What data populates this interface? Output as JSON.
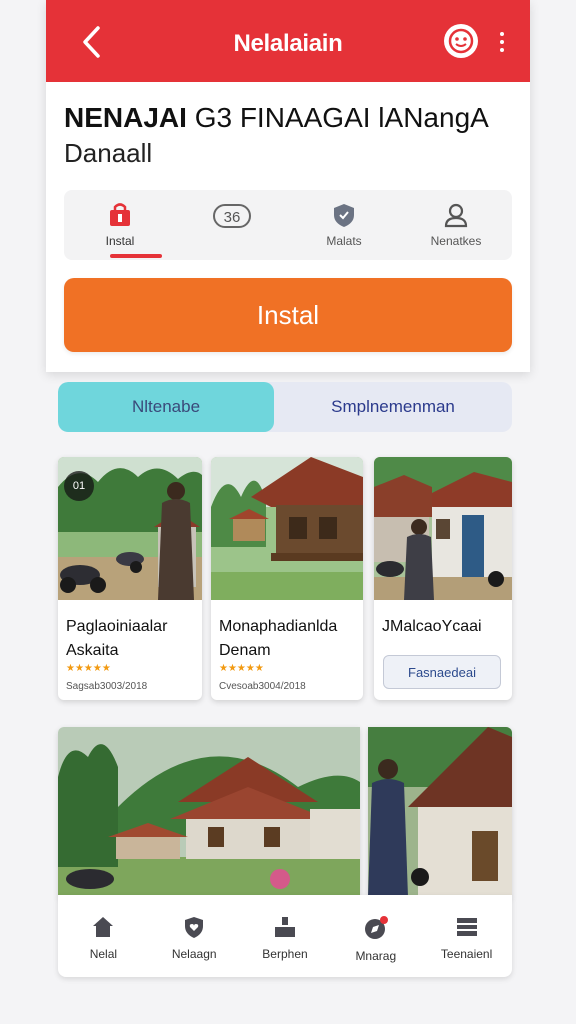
{
  "header": {
    "title": "Nelalaiain",
    "back_icon": "chevron-left-icon",
    "avatar_icon": "smiley-avatar-icon",
    "more_icon": "vertical-dots-icon",
    "bar_color": "#e53238"
  },
  "app": {
    "title_bold": "NENAJAI",
    "title_rest": " G3 FINAAGAI lANangA",
    "subtitle": "Danaall"
  },
  "tabs": [
    {
      "label": "Instal",
      "icon": "bag-icon",
      "active": true
    },
    {
      "label": "",
      "icon": "badge-36-icon",
      "active": false
    },
    {
      "label": "Malats",
      "icon": "shield-icon",
      "active": false
    },
    {
      "label": "Nenatkes",
      "icon": "user-icon",
      "active": false
    }
  ],
  "install_button": {
    "label": "Instal",
    "color": "#f07125"
  },
  "segment": {
    "active_label": "Nltenabe",
    "inactive_label": "Smplnemenman",
    "active_color": "#6fd6dc"
  },
  "cards": [
    {
      "title_line1": "Paglaoiniaalar",
      "title_line2": "Askaita",
      "stars": "★★★★★",
      "meta": "Sagsab3003/2018",
      "badge": "01"
    },
    {
      "title_line1": "Monaphadianlda",
      "title_line2": "Denam",
      "stars": "★★★★★",
      "meta": "Cvesoab3004/2018"
    },
    {
      "title_line1": "JMalcaoYcaai",
      "button_label": "Fasnaedeai"
    }
  ],
  "bottom_nav": [
    {
      "label": "Nelal",
      "icon": "home-icon"
    },
    {
      "label": "Nelaagn",
      "icon": "heart-shield-icon"
    },
    {
      "label": "Berphen",
      "icon": "person-upload-icon"
    },
    {
      "label": "Mnarag",
      "icon": "compass-icon"
    },
    {
      "label": "Teenaienl",
      "icon": "menu-icon"
    }
  ]
}
